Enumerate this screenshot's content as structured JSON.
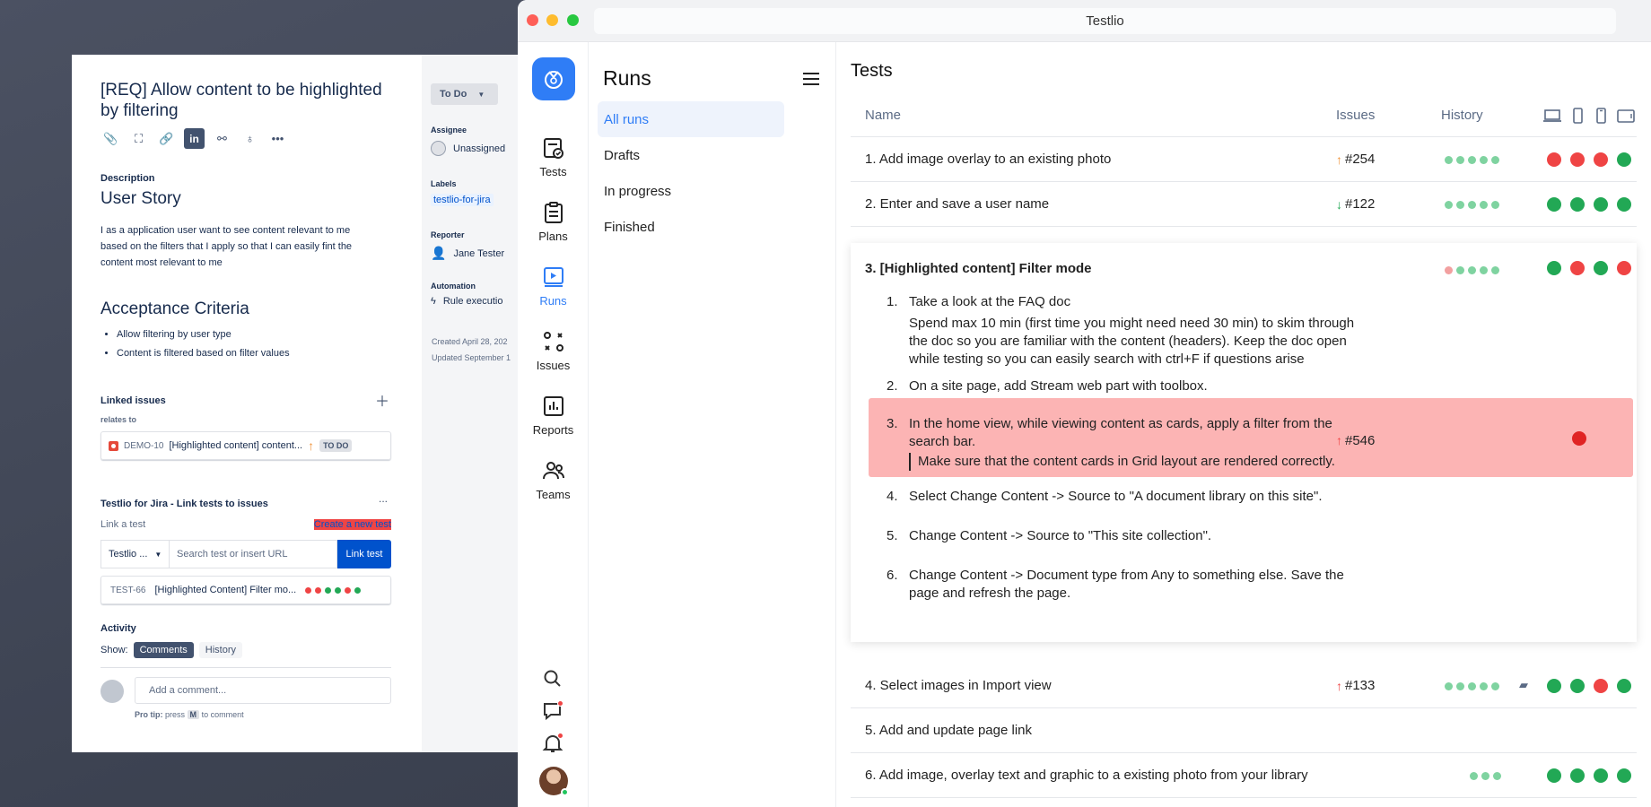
{
  "jira": {
    "title": "[REQ] Allow content to be highlighted by filtering",
    "description_label": "Description",
    "story_heading": "User Story",
    "story_text": "I as a application user want to see content relevant to me based on the filters that I apply so that I can easily fint the content most relevant to me",
    "ac_heading": "Acceptance Criteria",
    "ac_items": [
      "Allow filtering by user type",
      "Content is filtered based on filter values"
    ],
    "linked_issues_label": "Linked issues",
    "relates_to": "relates to",
    "linked_issue": {
      "key": "DEMO-10",
      "summary": "[Highlighted content] content...",
      "status": "TO DO"
    },
    "tfj_label": "Testlio for Jira - Link tests to issues",
    "tfj_more": "...",
    "link_test_label": "Link a test",
    "create_test": "Create a new test",
    "select_value": "Testlio ...",
    "search_placeholder": "Search test or insert URL",
    "link_button": "Link test",
    "test_item": {
      "key": "TEST-66",
      "summary": "[Highlighted Content] Filter mo...",
      "dots": [
        "#ef4444",
        "#ef4444",
        "#22a855",
        "#22a855",
        "#ef4444",
        "#22a855"
      ]
    },
    "activity": "Activity",
    "show": "Show:",
    "comments": "Comments",
    "history": "History",
    "comment_placeholder": "Add a comment...",
    "protip_a": "Pro tip:",
    "protip_b": "press",
    "protip_key": "M",
    "protip_c": "to comment",
    "status_button": "To Do",
    "assignee_label": "Assignee",
    "assignee": "Unassigned",
    "labels_label": "Labels",
    "label_tag": "testlio-for-jira",
    "reporter_label": "Reporter",
    "reporter": "Jane Tester",
    "automation_label": "Automation",
    "automation": "Rule executio",
    "created": "Created April 28, 202",
    "updated": "Updated September 1"
  },
  "window": {
    "title": "Testlio"
  },
  "rail": {
    "items": [
      {
        "label": "Tests"
      },
      {
        "label": "Plans"
      },
      {
        "label": "Runs"
      },
      {
        "label": "Issues"
      },
      {
        "label": "Reports"
      },
      {
        "label": "Teams"
      }
    ]
  },
  "runs": {
    "title": "Runs",
    "items": [
      "All runs",
      "Drafts",
      "In progress",
      "Finished"
    ]
  },
  "tests": {
    "title": "Tests",
    "headers": {
      "name": "Name",
      "issues": "Issues",
      "history": "History"
    },
    "rows": [
      {
        "name": "1.  Add image overlay to an existing photo",
        "issue": "#254"
      },
      {
        "name": "2.  Enter and save a user name",
        "issue": "#122"
      },
      {
        "name": "4.  Select images in Import view",
        "issue": "#133"
      },
      {
        "name": "5.  Add and update page link",
        "issue": ""
      },
      {
        "name": "6.  Add image, overlay text and graphic to a existing photo from your library",
        "issue": ""
      }
    ],
    "expanded": {
      "title": "3.  [Highlighted content] Filter mode",
      "steps": [
        {
          "n": "1.",
          "text": "Take a look at the FAQ doc",
          "detail": "Spend max 10 min (first time you might need need 30 min) to skim through the doc so you are familiar with the content (headers). Keep the doc open while testing so you can easily search with ctrl+F if questions arise"
        },
        {
          "n": "2.",
          "text": "On a site page, add Stream web part with toolbox."
        },
        {
          "n": "3.",
          "text": "In the home view, while viewing content as cards, apply a filter from the search bar.",
          "note": "Make sure that the content cards in Grid layout are rendered correctly.",
          "issue": "#546"
        },
        {
          "n": "4.",
          "text": "Select Change Content -> Source to \"A document library on this site\"."
        },
        {
          "n": "5.",
          "text": "Change Content -> Source to \"This site collection\"."
        },
        {
          "n": "6.",
          "text": "Change Content -> Document type from Any to something else. Save the page and refresh the page."
        }
      ]
    }
  }
}
